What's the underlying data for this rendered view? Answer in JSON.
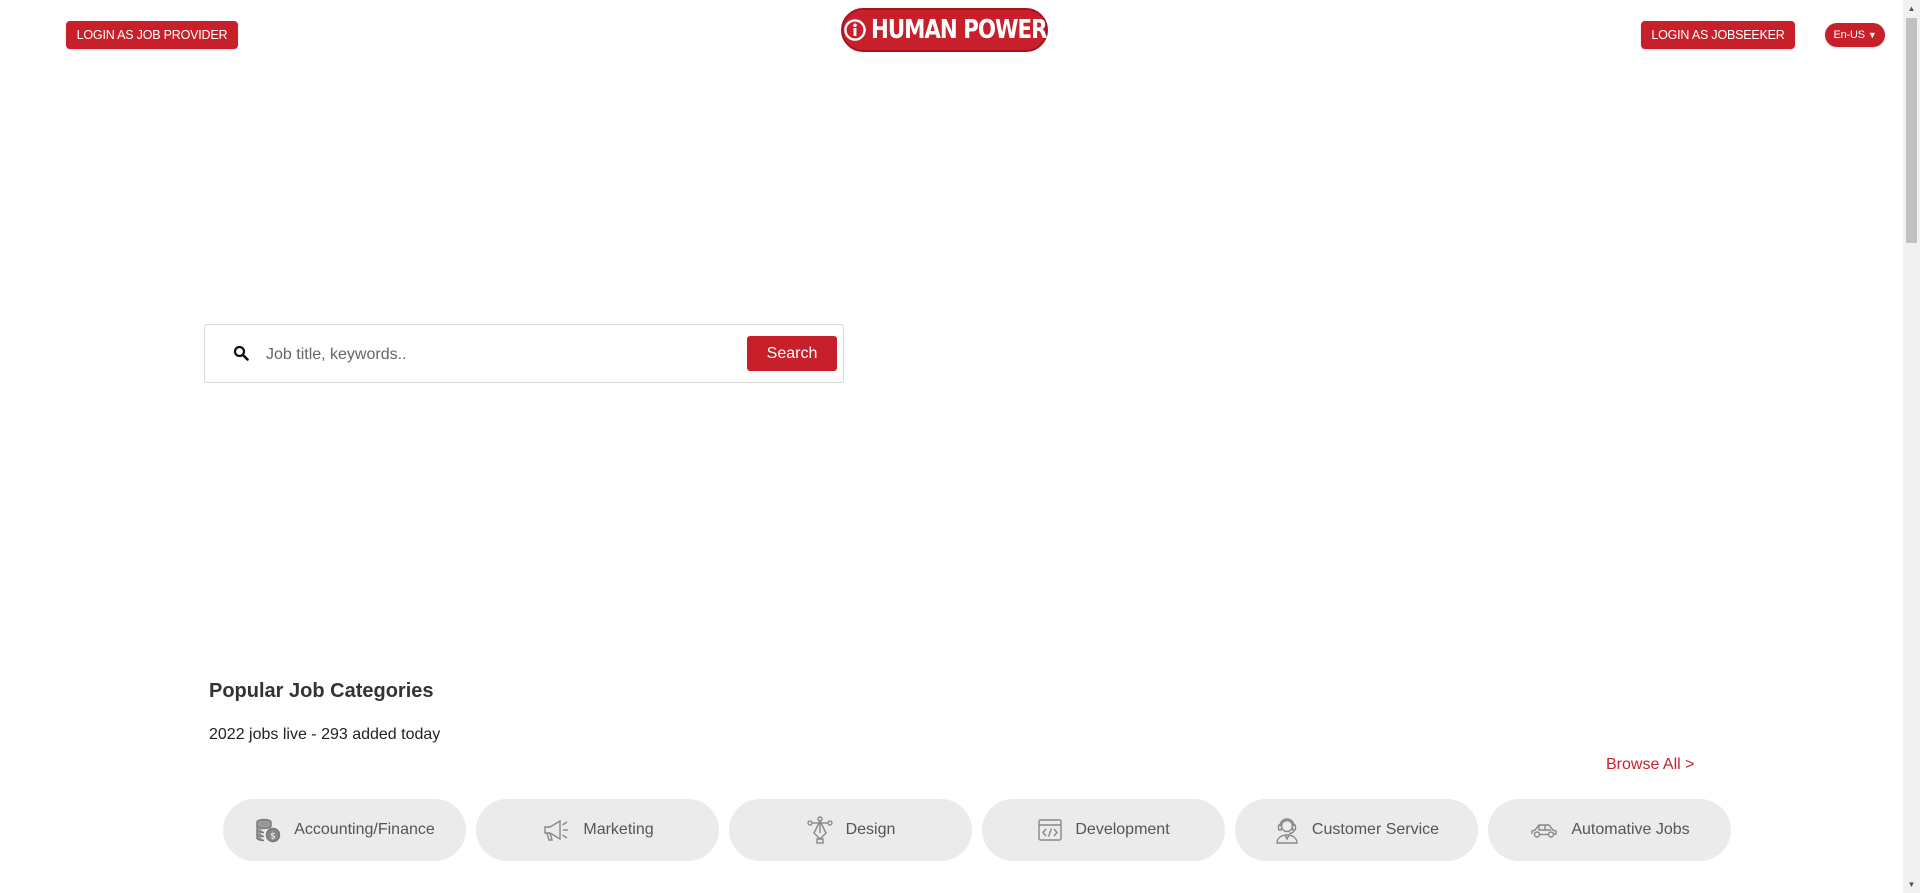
{
  "header": {
    "login_provider_label": "LOGIN AS JOB PROVIDER",
    "login_seeker_label": "LOGIN AS JOBSEEKER",
    "language_label": "En-US",
    "logo_text": "HUMAN POWER"
  },
  "search": {
    "placeholder": "Job title, keywords..",
    "button_label": "Search"
  },
  "categories_section": {
    "title": "Popular Job Categories",
    "jobs_count_text": "2022 jobs live - 293 added today",
    "browse_all_label": "Browse All >",
    "items": [
      {
        "label": "Accounting/Finance",
        "icon": "coins-icon"
      },
      {
        "label": "Marketing",
        "icon": "megaphone-icon"
      },
      {
        "label": "Design",
        "icon": "pen-tool-icon"
      },
      {
        "label": "Development",
        "icon": "code-window-icon"
      },
      {
        "label": "Customer Service",
        "icon": "headset-agent-icon"
      },
      {
        "label": "Automative Jobs",
        "icon": "car-icon"
      }
    ]
  },
  "colors": {
    "accent": "#c8202b",
    "pill_background": "#ebebeb"
  }
}
